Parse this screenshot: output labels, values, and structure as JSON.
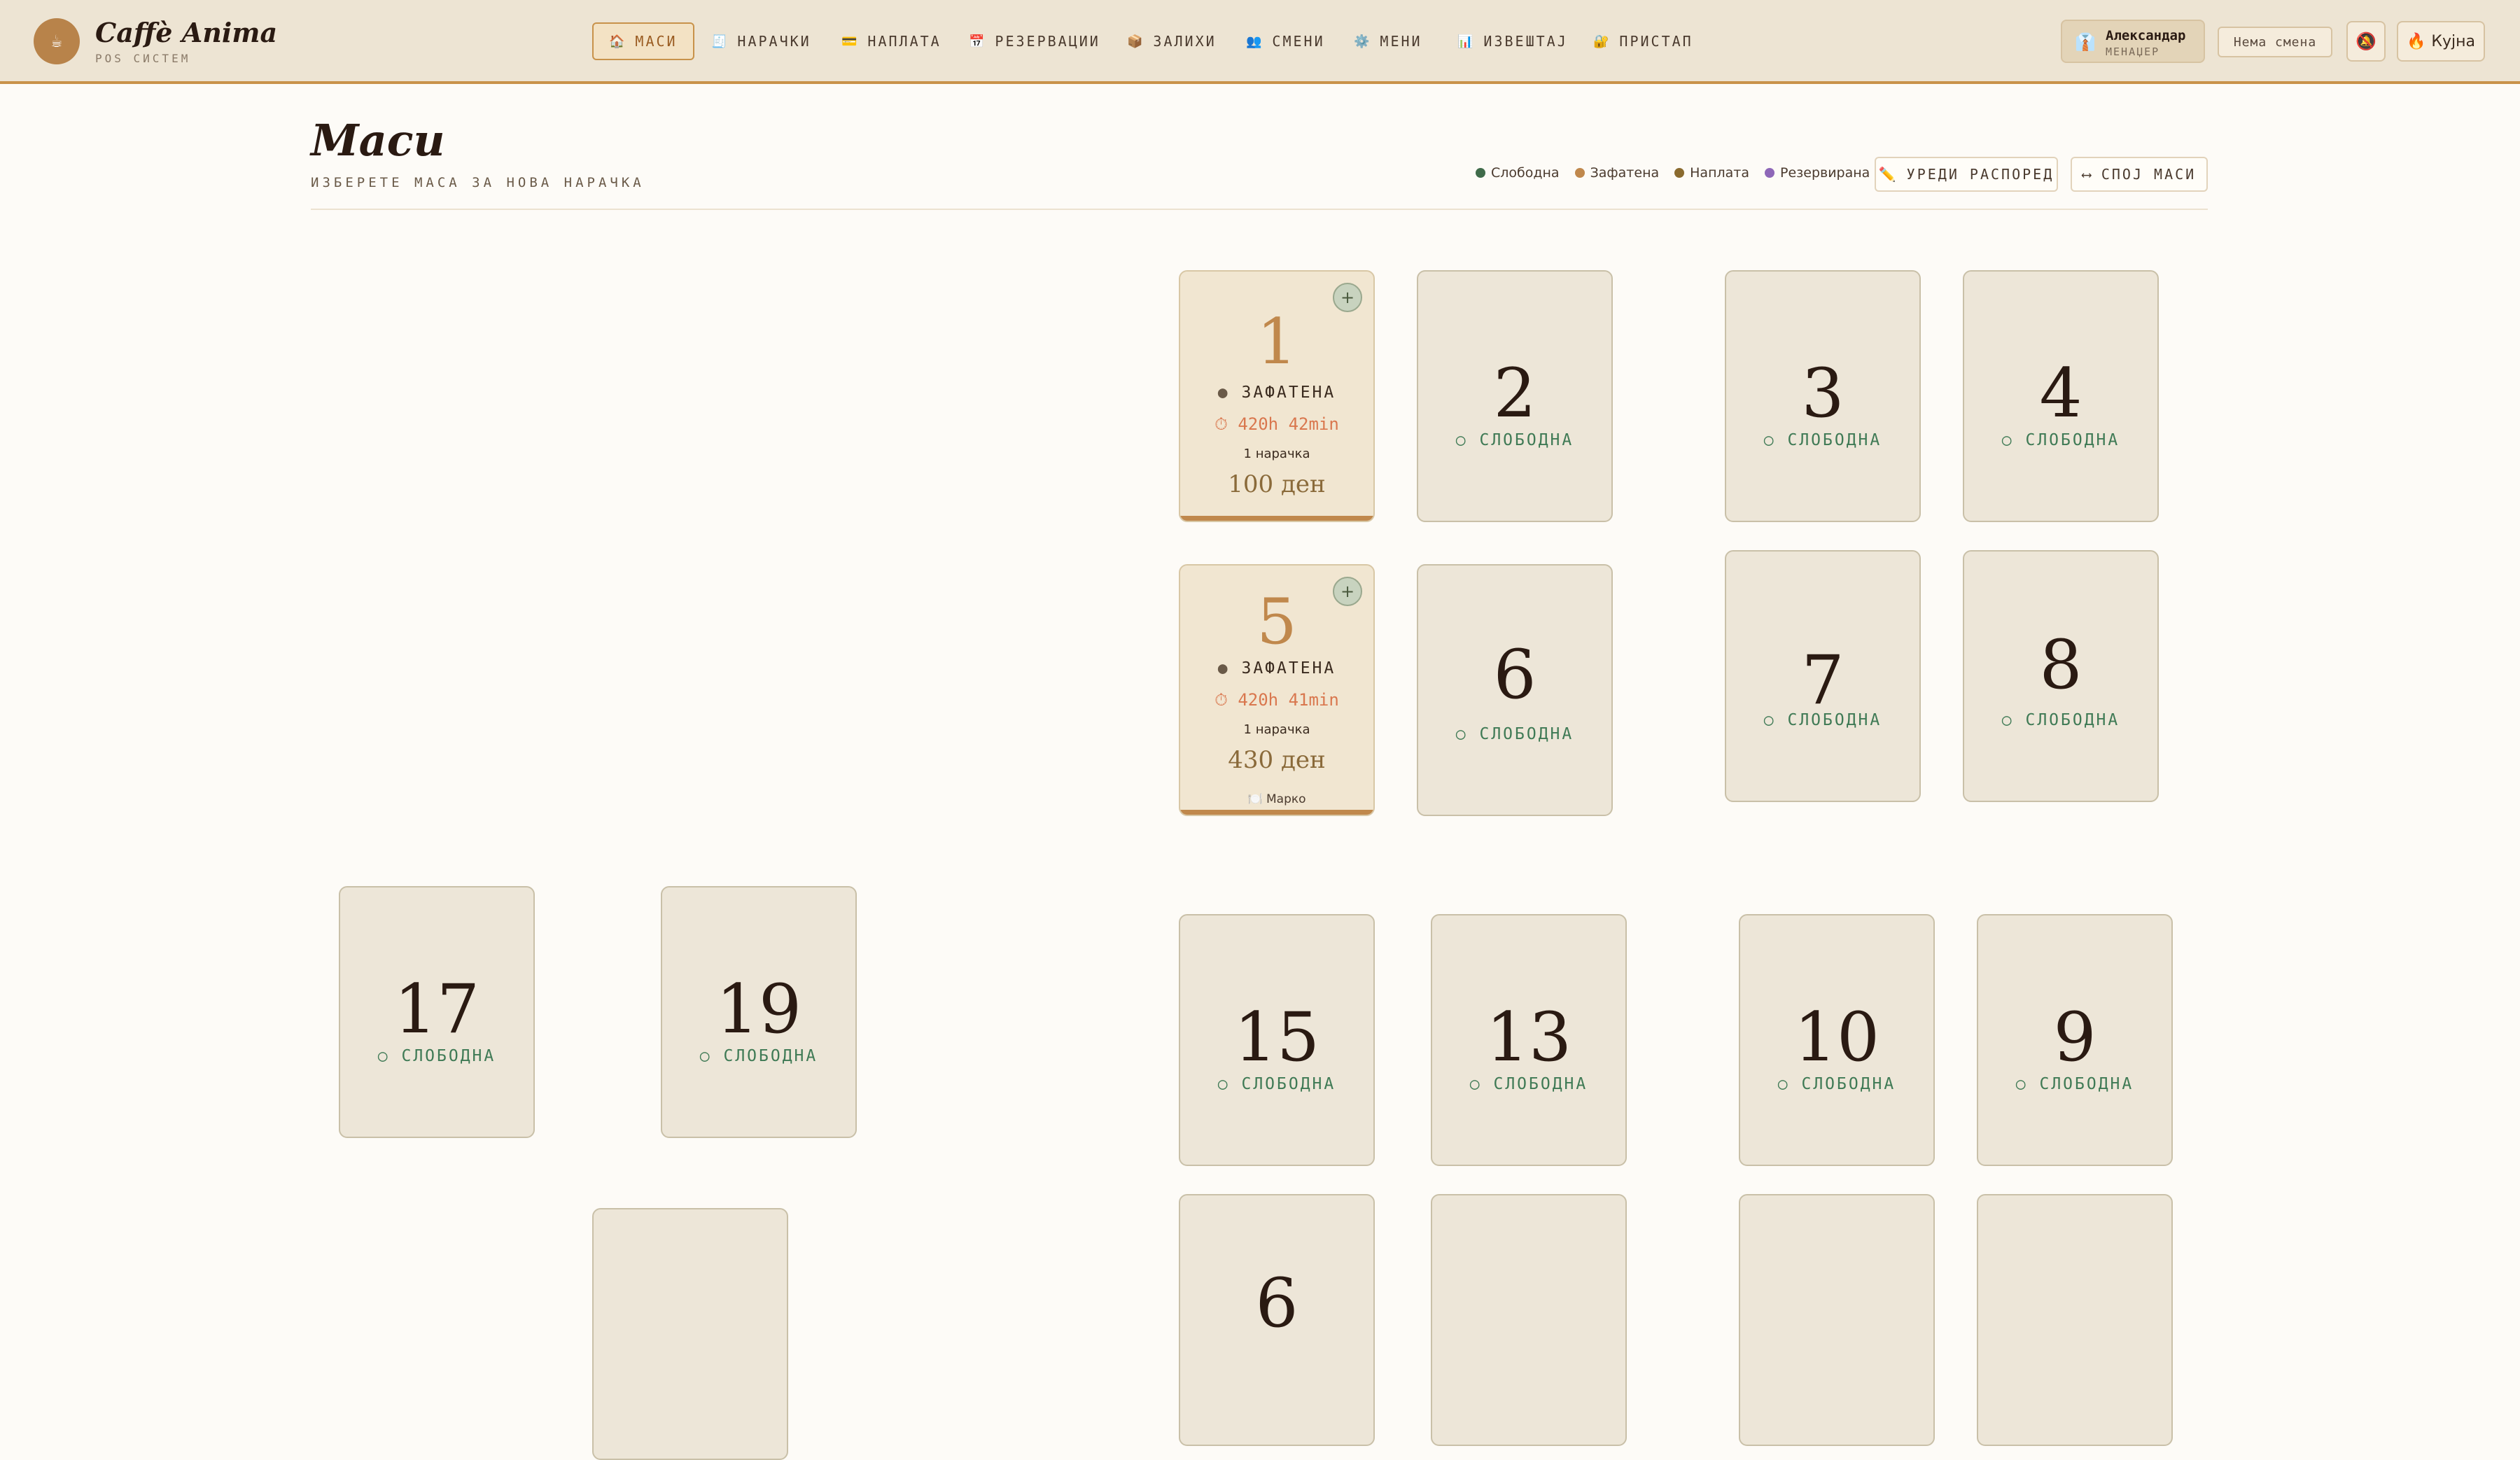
{
  "app": {
    "name": "Caffè Anima",
    "subtitle": "POS СИСТЕМ",
    "logo_icon": "☕"
  },
  "nav": [
    {
      "icon": "🏠",
      "icon_name": "home-icon",
      "label": "МАСИ",
      "active": true
    },
    {
      "icon": "🧾",
      "icon_name": "receipt-icon",
      "label": "НАРАЧКИ"
    },
    {
      "icon": "💳",
      "icon_name": "card-icon",
      "label": "НАПЛАТА"
    },
    {
      "icon": "📅",
      "icon_name": "calendar-icon",
      "label": "РЕЗЕРВАЦИИ"
    },
    {
      "icon": "📦",
      "icon_name": "box-icon",
      "label": "ЗАЛИХИ"
    },
    {
      "icon": "👥",
      "icon_name": "people-icon",
      "label": "СМЕНИ"
    },
    {
      "icon": "⚙️",
      "icon_name": "gear-icon",
      "label": "МЕНИ"
    },
    {
      "icon": "📊",
      "icon_name": "chart-icon",
      "label": "ИЗВЕШТАЈ"
    },
    {
      "icon": "🔐",
      "icon_name": "lock-icon",
      "label": "ПРИСТАП"
    }
  ],
  "user": {
    "name": "Александар",
    "role": "МЕНАЏЕР",
    "icon": "👔"
  },
  "shift": {
    "label": "Нема смена"
  },
  "notifications": {
    "icon": "🔕"
  },
  "kitchen": {
    "icon": "🔥",
    "label": "Кујна"
  },
  "page": {
    "title": "Маси",
    "subtitle": "ИЗБЕРЕТЕ МАСА ЗА НОВА НАРАЧКА"
  },
  "legend": [
    {
      "label": "Слободна",
      "color": "#3f6b4a"
    },
    {
      "label": "Зафатена",
      "color": "#c0884c"
    },
    {
      "label": "Наплата",
      "color": "#8a6a2e"
    },
    {
      "label": "Резервирана",
      "color": "#8e67b8"
    }
  ],
  "actions": {
    "edit_layout": {
      "icon": "✏️",
      "label": "УРЕДИ РАСПОРЕД"
    },
    "merge_tables": {
      "icon": "⟷",
      "label": "СПОЈ МАСИ"
    }
  },
  "tables": [
    {
      "number": "1",
      "status": "ЗАФАТЕНА",
      "status_dot": "●",
      "time": "⏱ 420h 42min",
      "orders": "1 нарачка",
      "amount": "100 ден",
      "add": "+"
    },
    {
      "number": "2",
      "status": "СЛОБОДНА",
      "status_dot": "○"
    },
    {
      "number": "3",
      "status": "СЛОБОДНА",
      "status_dot": "○"
    },
    {
      "number": "4",
      "status": "СЛОБОДНА",
      "status_dot": "○"
    },
    {
      "number": "5",
      "status": "ЗАФАТЕНА",
      "status_dot": "●",
      "time": "⏱ 420h 41min",
      "orders": "1 нарачка",
      "amount": "430 ден",
      "waiter": "🍽️ Марко",
      "add": "+"
    },
    {
      "number": "6",
      "status": "СЛОБОДНА",
      "status_dot": "○"
    },
    {
      "number": "7",
      "status": "СЛОБОДНА",
      "status_dot": "○"
    },
    {
      "number": "8",
      "status": "СЛОБОДНА",
      "status_dot": "○"
    },
    {
      "number": "17",
      "status": "СЛОБОДНА",
      "status_dot": "○"
    },
    {
      "number": "19",
      "status": "СЛОБОДНА",
      "status_dot": "○"
    },
    {
      "number": "15",
      "status": "СЛОБОДНА",
      "status_dot": "○"
    },
    {
      "number": "13",
      "status": "СЛОБОДНА",
      "status_dot": "○"
    },
    {
      "number": "10",
      "status": "СЛОБОДНА",
      "status_dot": "○"
    },
    {
      "number": "9",
      "status": "СЛОБОДНА",
      "status_dot": "○"
    },
    {
      "number": "",
      "status": ""
    },
    {
      "number": "",
      "status": ""
    },
    {
      "number": "6",
      "status": ""
    },
    {
      "number": "",
      "status": ""
    },
    {
      "number": "",
      "status": ""
    }
  ]
}
